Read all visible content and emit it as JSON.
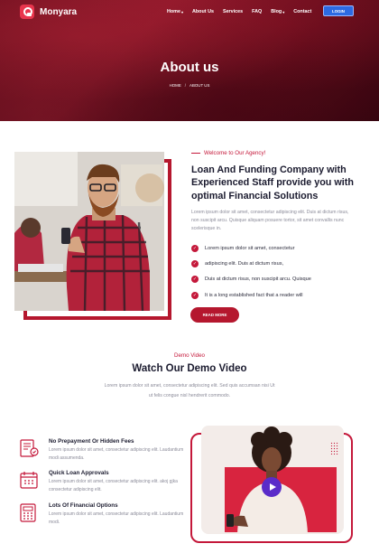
{
  "brand": {
    "name": "Monyara"
  },
  "nav": {
    "items": [
      {
        "label": "Home",
        "dropdown": true
      },
      {
        "label": "About Us",
        "dropdown": false
      },
      {
        "label": "Services",
        "dropdown": false
      },
      {
        "label": "FAQ",
        "dropdown": false
      },
      {
        "label": "Blog",
        "dropdown": true
      },
      {
        "label": "Contact",
        "dropdown": false
      }
    ],
    "login_label": "LOGIN"
  },
  "hero": {
    "title": "About us",
    "breadcrumb": [
      "HOME",
      "ABOUT US"
    ]
  },
  "about": {
    "tag": "Welcome to Our Agency!",
    "title": "Loan And Funding Company with Experienced Staff provide you with optimal Financial Solutions",
    "paragraph": "Lorem ipsum dolor sit amet, consectetur adipiscing elit. Duis at dictum risus, non suscipit arcu. Quisque aliquam posuere tortor, sit amet convallis nunc scelerisque in.",
    "checks": [
      "Lorem ipsum dolor sit amet, consectetur",
      "adipiscing elit. Duis at dictum risus,",
      "Duis at dictum risus, non suscipit arcu. Quisque",
      "It is a long established fact that a reader will"
    ],
    "read_more": "READ MORE"
  },
  "demo": {
    "tag": "Demo Video",
    "title": "Watch Our Demo Video",
    "paragraph": "Lorem ipsum dolor sit amet, consectetur adipiscing elit. Sed quis accumsan nisi Ut ut felis congue nisl hendrerit commodo."
  },
  "features": [
    {
      "icon": "document-icon",
      "title": "No Prepayment Or Hidden Fees",
      "desc": "Lorem ipsum dolor sit amet, consectetur adipiscing elit. Laudantium modi assumenda."
    },
    {
      "icon": "calendar-icon",
      "title": "Quick Loan Approvals",
      "desc": "Lorem ipsum dolor sit amet, consectetur adipiscing elit. akoj gjka consectetur adipiscing elit."
    },
    {
      "icon": "calculator-icon",
      "title": "Lots Of Financial Options",
      "desc": "Lorem ipsum dolor sit amet, consectetur adipiscing elit. Laudantium modi."
    }
  ],
  "colors": {
    "brand": "#c4183a",
    "login": "#2c6ae3",
    "play": "#5a2bc9"
  }
}
